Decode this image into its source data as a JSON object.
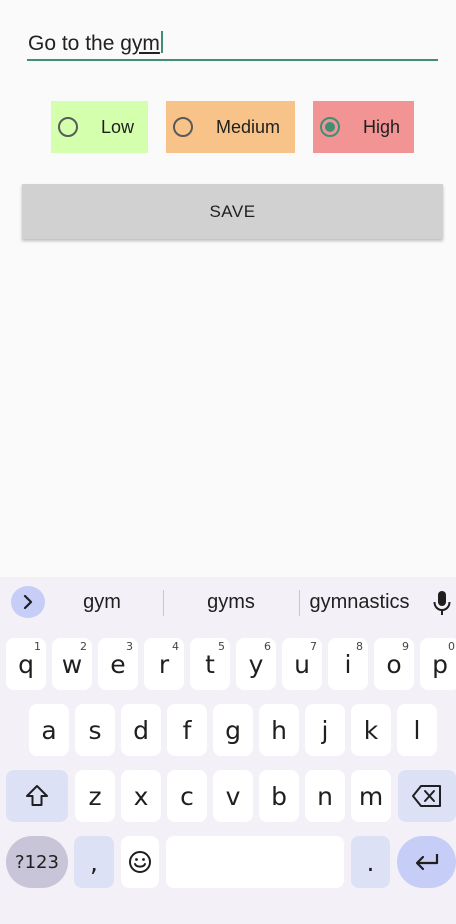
{
  "task": {
    "text_prefix": "Go to the ",
    "text_composing": "gym"
  },
  "priority": {
    "options": [
      {
        "label": "Low",
        "color": "#d4ffad",
        "selected": false
      },
      {
        "label": "Medium",
        "color": "#f7c388",
        "selected": false
      },
      {
        "label": "High",
        "color": "#f29394",
        "selected": true
      }
    ]
  },
  "save_button": {
    "label": "SAVE"
  },
  "keyboard": {
    "suggestions": [
      "gym",
      "gyms",
      "gymnastics"
    ],
    "row1": [
      {
        "key": "q",
        "hint": "1"
      },
      {
        "key": "w",
        "hint": "2"
      },
      {
        "key": "e",
        "hint": "3"
      },
      {
        "key": "r",
        "hint": "4"
      },
      {
        "key": "t",
        "hint": "5"
      },
      {
        "key": "y",
        "hint": "6"
      },
      {
        "key": "u",
        "hint": "7"
      },
      {
        "key": "i",
        "hint": "8"
      },
      {
        "key": "o",
        "hint": "9"
      },
      {
        "key": "p",
        "hint": "0"
      }
    ],
    "row2": [
      "a",
      "s",
      "d",
      "f",
      "g",
      "h",
      "j",
      "k",
      "l"
    ],
    "row3": [
      "z",
      "x",
      "c",
      "v",
      "b",
      "n",
      "m"
    ],
    "symbols_label": "?123",
    "comma_label": ",",
    "period_label": "."
  }
}
